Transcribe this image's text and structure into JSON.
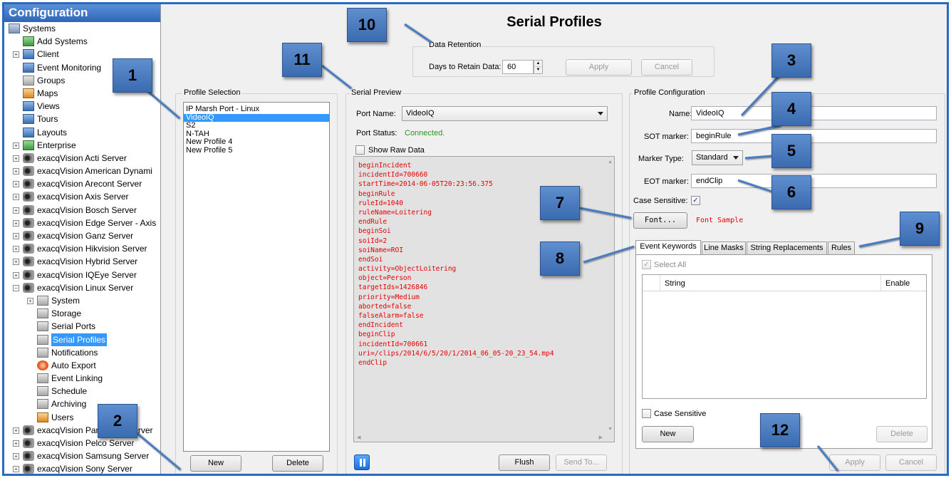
{
  "tree": {
    "title": "Configuration",
    "items": [
      {
        "label": "Systems",
        "icon": "systems-icon"
      },
      {
        "label": "Add Systems",
        "icon": "add-systems-icon"
      },
      {
        "label": "Client",
        "icon": "client-icon"
      },
      {
        "label": "Event Monitoring",
        "icon": "event-monitoring-icon"
      },
      {
        "label": "Groups",
        "icon": "groups-icon"
      },
      {
        "label": "Maps",
        "icon": "maps-icon"
      },
      {
        "label": "Views",
        "icon": "views-icon"
      },
      {
        "label": "Tours",
        "icon": "tours-icon"
      },
      {
        "label": "Layouts",
        "icon": "layouts-icon"
      },
      {
        "label": "Enterprise",
        "icon": "enterprise-icon"
      },
      {
        "label": "exacqVision Acti Server",
        "icon": "server-icon"
      },
      {
        "label": "exacqVision American Dynami",
        "icon": "server-icon"
      },
      {
        "label": "exacqVision Arecont Server",
        "icon": "server-icon"
      },
      {
        "label": "exacqVision Axis Server",
        "icon": "server-icon"
      },
      {
        "label": "exacqVision Bosch Server",
        "icon": "server-icon"
      },
      {
        "label": "exacqVision Edge Server - Axis",
        "icon": "server-icon"
      },
      {
        "label": "exacqVision Ganz Server",
        "icon": "server-icon"
      },
      {
        "label": "exacqVision Hikvision Server",
        "icon": "server-icon"
      },
      {
        "label": "exacqVision Hybrid Server",
        "icon": "server-icon"
      },
      {
        "label": "exacqVision IQEye Server",
        "icon": "server-icon"
      },
      {
        "label": "exacqVision Linux Server",
        "icon": "server-icon"
      },
      {
        "label": "System",
        "icon": "system-icon"
      },
      {
        "label": "Storage",
        "icon": "storage-icon"
      },
      {
        "label": "Serial Ports",
        "icon": "serial-ports-icon"
      },
      {
        "label": "Serial Profiles",
        "icon": "serial-profiles-icon"
      },
      {
        "label": "Notifications",
        "icon": "notifications-icon"
      },
      {
        "label": "Auto Export",
        "icon": "auto-export-icon"
      },
      {
        "label": "Event Linking",
        "icon": "event-linking-icon"
      },
      {
        "label": "Schedule",
        "icon": "schedule-icon"
      },
      {
        "label": "Archiving",
        "icon": "archiving-icon"
      },
      {
        "label": "Users",
        "icon": "users-icon"
      },
      {
        "label": "exacqVision Panasonic Server",
        "icon": "server-icon"
      },
      {
        "label": "exacqVision Pelco Server",
        "icon": "server-icon"
      },
      {
        "label": "exacqVision Samsung Server",
        "icon": "server-icon"
      },
      {
        "label": "exacqVision Sony Server",
        "icon": "server-icon"
      }
    ]
  },
  "page_title": "Serial Profiles",
  "retention": {
    "group_label": "Data Retention",
    "days_label": "Days to Retain Data:",
    "days_value": "60",
    "apply_label": "Apply",
    "cancel_label": "Cancel"
  },
  "profile_selection": {
    "group_label": "Profile Selection",
    "profiles": [
      "IP Marsh Port - Linux",
      "VideoIQ",
      "S2",
      "N-TAH",
      "New Profile 4",
      "New Profile 5"
    ],
    "selected": "VideoIQ",
    "new_label": "New",
    "delete_label": "Delete"
  },
  "serial_preview": {
    "group_label": "Serial Preview",
    "port_name_label": "Port Name:",
    "port_name_value": "VideoIQ",
    "port_status_label": "Port Status:",
    "port_status_value": "Connected.",
    "status_color": "#1f9a1f",
    "show_raw_label": "Show Raw Data",
    "lines": [
      "beginIncident",
      "incidentId=700660",
      "startTime=2014-06-05T20:23:56.375",
      "beginRule",
      "ruleId=1040",
      "ruleName=Loitering",
      "endRule",
      "beginSoi",
      "soiId=2",
      "soiName=ROI",
      "endSoi",
      "activity=ObjectLoitering",
      "object=Person",
      "targetIds=1426846",
      "priority=Medium",
      "aborted=false",
      "falseAlarm=false",
      "endIncident",
      "beginClip",
      "incidentId=700661",
      "uri=/clips/2014/6/5/20/1/2014_06_05-20_23_54.mp4",
      "endClip"
    ],
    "text_color": "#e60000",
    "flush_label": "Flush",
    "send_to_label": "Send To..."
  },
  "profile_config": {
    "group_label": "Profile Configuration",
    "name_label": "Name:",
    "name_value": "VideoIQ",
    "sot_label": "SOT marker:",
    "sot_value": "beginRule",
    "marker_type_label": "Marker Type:",
    "marker_type_value": "Standard",
    "eot_label": "EOT marker:",
    "eot_value": "endClip",
    "case_sensitive_label": "Case Sensitive:",
    "case_sensitive_checked": true,
    "font_button_label": "Font...",
    "font_sample": "Font Sample",
    "tabs": [
      "Event Keywords",
      "Line Masks",
      "String Replacements",
      "Rules"
    ],
    "active_tab": "Event Keywords",
    "select_all_label": "Select All",
    "col_string": "String",
    "col_enable": "Enable",
    "case_sensitive_kw_label": "Case Sensitive",
    "new_label": "New",
    "delete_label": "Delete",
    "apply_label": "Apply",
    "cancel_label": "Cancel"
  },
  "callouts": [
    "1",
    "2",
    "3",
    "4",
    "5",
    "6",
    "7",
    "8",
    "9",
    "10",
    "11",
    "12"
  ],
  "colors": {
    "accent": "#2a6bc2",
    "callout": "#4a7cc0",
    "selection": "#3399ff"
  }
}
